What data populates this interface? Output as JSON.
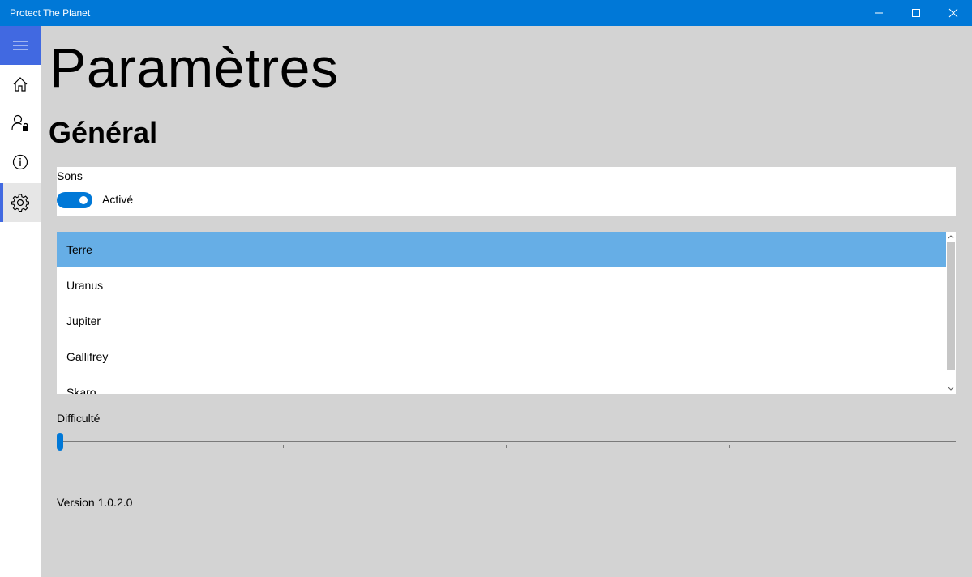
{
  "window": {
    "title": "Protect The Planet",
    "minimize_icon": "minimize-icon",
    "maximize_icon": "maximize-icon",
    "close_icon": "close-icon"
  },
  "nav": {
    "items": [
      {
        "icon": "hamburger-icon"
      },
      {
        "icon": "home-icon"
      },
      {
        "icon": "user-lock-icon"
      },
      {
        "icon": "info-icon"
      },
      {
        "icon": "gear-icon",
        "selected": true
      }
    ]
  },
  "page": {
    "title": "Paramètres",
    "section": "Général"
  },
  "sound": {
    "label": "Sons",
    "state_text": "Activé",
    "enabled": true
  },
  "planets": {
    "items": [
      "Terre",
      "Uranus",
      "Jupiter",
      "Gallifrey",
      "Skaro"
    ],
    "selected": "Terre"
  },
  "difficulty": {
    "label": "Difficulté",
    "value_fraction": 0.0
  },
  "version": "Version 1.0.2.0",
  "colors": {
    "accent": "#0078d7",
    "nav_accent": "#4169e1",
    "selection": "#66aee6",
    "background": "#d3d3d3"
  }
}
